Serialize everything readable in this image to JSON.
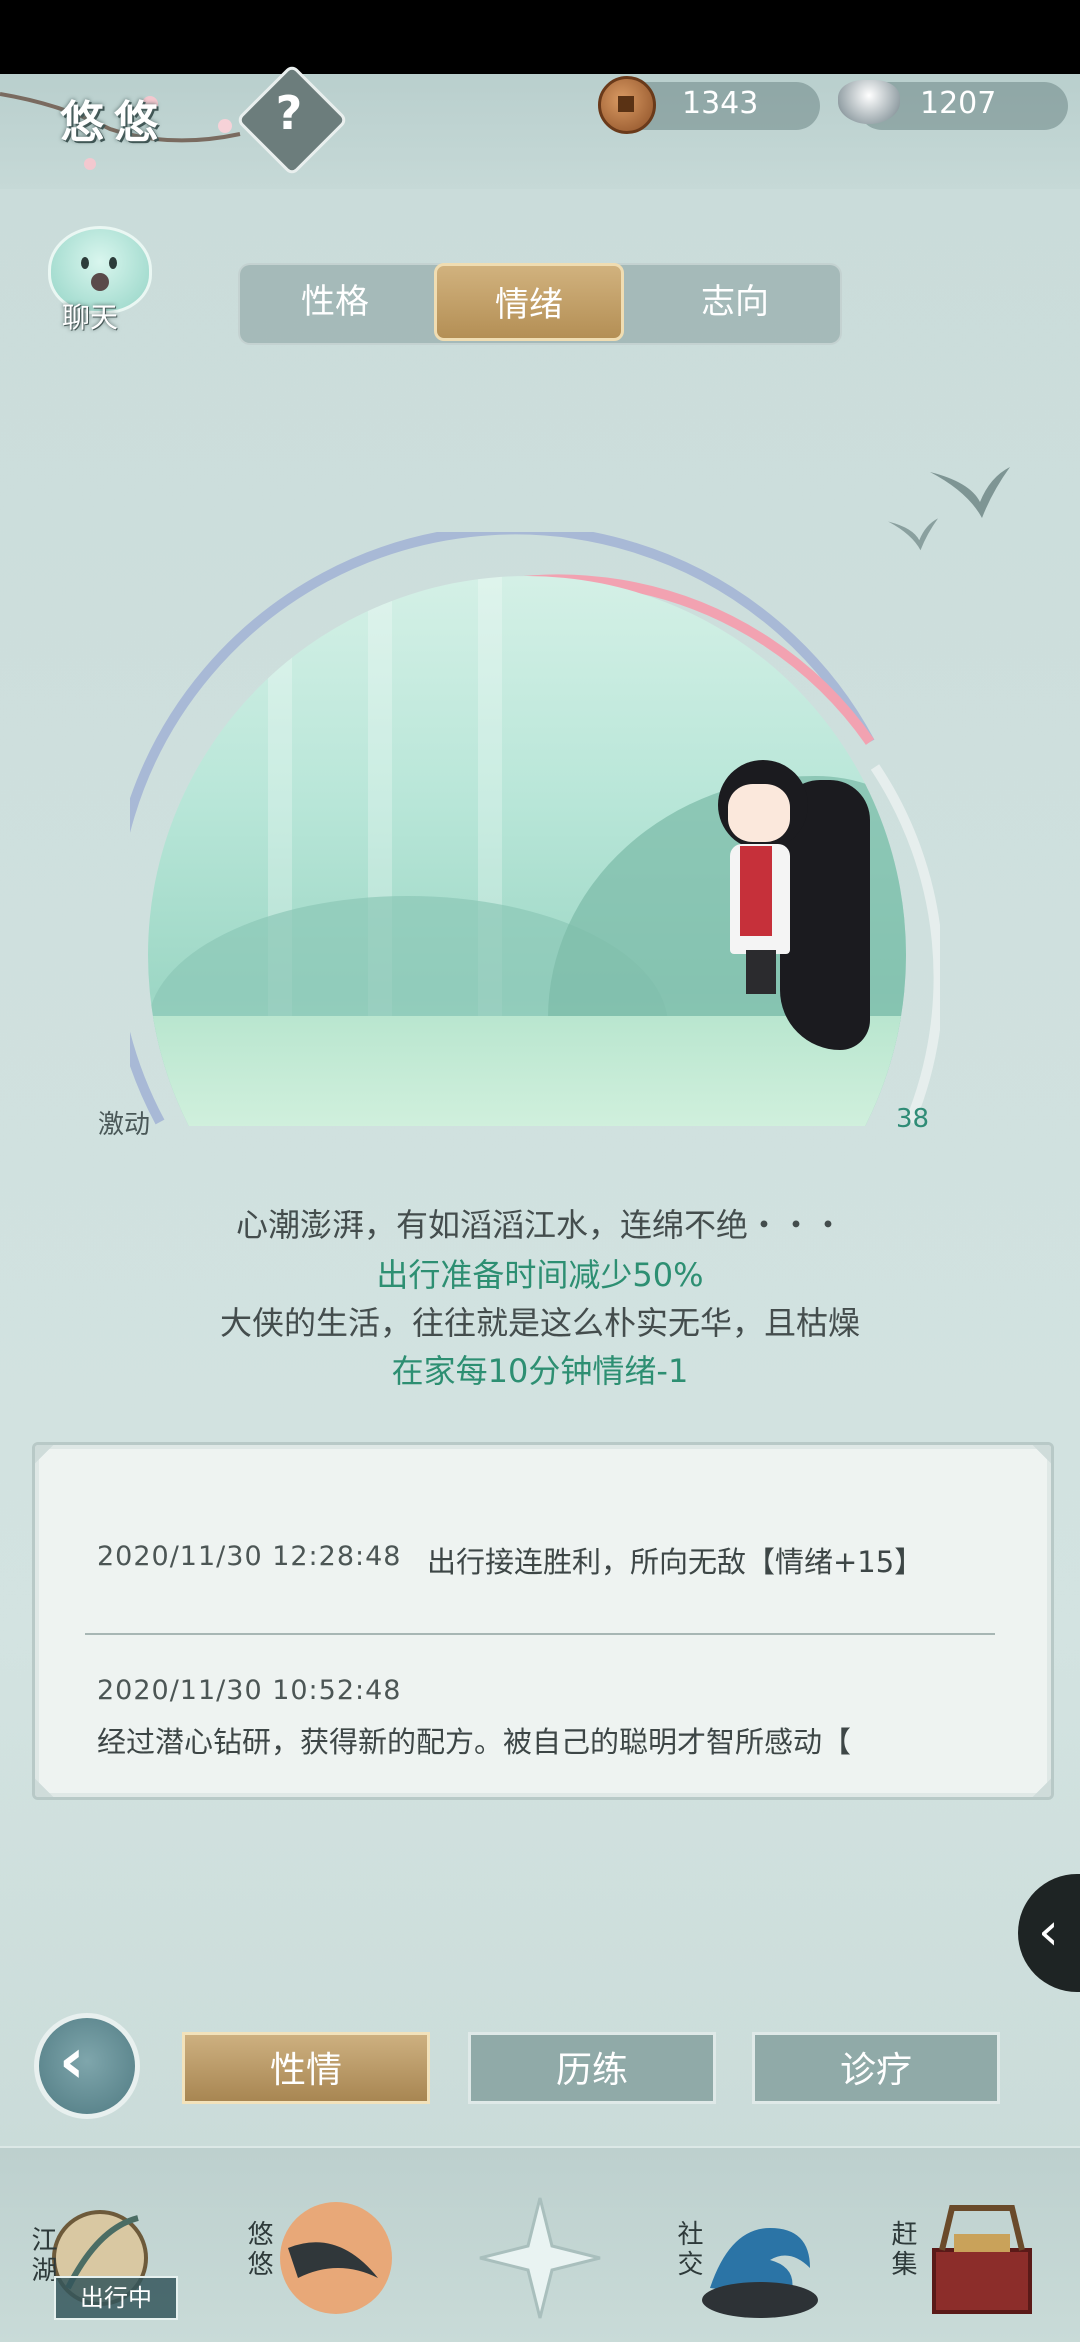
{
  "header": {
    "name": "悠悠",
    "help_icon": "question-icon"
  },
  "currency": {
    "copper": "1343",
    "silver": "1207"
  },
  "chat": {
    "label": "聊天"
  },
  "tabs": [
    {
      "label": "性格"
    },
    {
      "label": "情绪",
      "active": true
    },
    {
      "label": "志向"
    }
  ],
  "mood": {
    "left_label": "激动",
    "value": "38"
  },
  "description": {
    "line1": "心潮澎湃，有如滔滔江水，连绵不绝・・・",
    "line2": "出行准备时间减少50%",
    "line3": "大侠的生活，往往就是这么朴实无华，且枯燥",
    "line4": "在家每10分钟情绪-1"
  },
  "log": [
    {
      "date": "2020/11/30 12:28:48",
      "text": "出行接连胜利，所向无敌【情绪+15】"
    },
    {
      "date": "2020/11/30 10:52:48",
      "text": "经过潜心钻研，获得新的配方。被自己的聪明才智所感动【"
    }
  ],
  "bottom_nav": {
    "tab1": "性情",
    "tab2": "历练",
    "tab3": "诊疗"
  },
  "dock": {
    "item1": "江湖",
    "item1_badge": "出行中",
    "item2": "悠悠",
    "item4": "社交",
    "item5": "赶集"
  },
  "colors": {
    "accent_gold": "#b48f55",
    "green_text": "#2d8f72",
    "mood_pink": "#f0a0b0"
  }
}
